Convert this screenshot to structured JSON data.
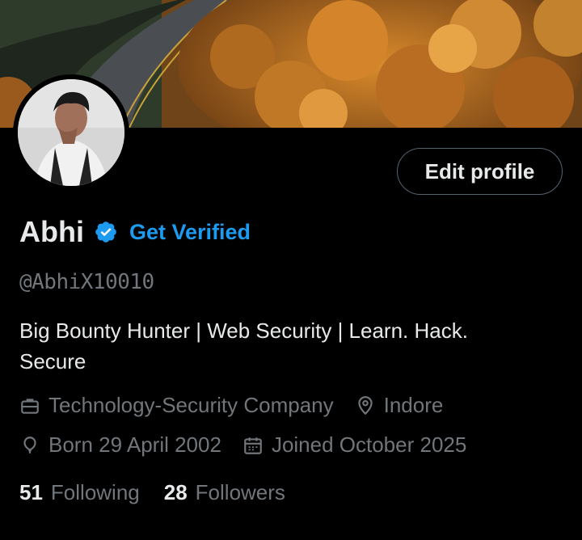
{
  "profile": {
    "name": "Abhi",
    "get_verified": "Get Verified",
    "handle": "@AbhiX10010",
    "bio": "Big Bounty Hunter | Web Security | Learn. Hack. Secure",
    "category": "Technology-Security Company",
    "location": "Indore",
    "birthday": "Born 29 April 2002",
    "joined": "Joined October 2025",
    "following_count": "51",
    "following_label": "Following",
    "followers_count": "28",
    "followers_label": "Followers"
  },
  "actions": {
    "edit_profile": "Edit profile"
  },
  "icons": {
    "verified": "verified-badge-icon",
    "category": "briefcase-icon",
    "location": "location-pin-icon",
    "birthday": "balloon-icon",
    "joined": "calendar-icon"
  },
  "colors": {
    "accent": "#1d9bf0",
    "muted": "#71767b",
    "text": "#e7e9ea",
    "background": "#000000"
  }
}
